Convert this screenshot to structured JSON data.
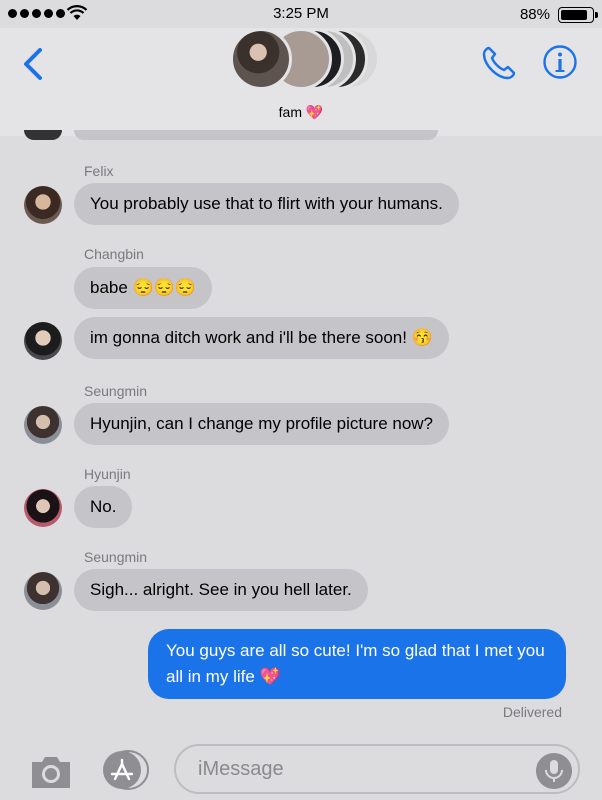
{
  "status_bar": {
    "time": "3:25 PM",
    "battery": "88%",
    "battery_level": 0.88
  },
  "header": {
    "group_name": "fam 💖"
  },
  "messages": [
    {
      "sender": "Felix",
      "text": "You probably use that to flirt with your humans."
    },
    {
      "sender": "Changbin",
      "text": "babe 😔😔😔"
    },
    {
      "sender": "",
      "text": "im gonna ditch work and i'll be there soon! 😚"
    },
    {
      "sender": "Seungmin",
      "text": "Hyunjin, can I change my profile picture now?"
    },
    {
      "sender": "Hyunjin",
      "text": "No."
    },
    {
      "sender": "Seungmin",
      "text": "Sigh... alright. See in you hell later."
    }
  ],
  "outgoing": {
    "text": "You guys are all so cute! I'm so glad that I met you all in my life 💖",
    "status": "Delivered"
  },
  "input": {
    "placeholder": "iMessage"
  },
  "colors": {
    "accent": "#1a73e8",
    "incoming_bubble": "#c5c5c9",
    "background": "#dcdcdf"
  }
}
